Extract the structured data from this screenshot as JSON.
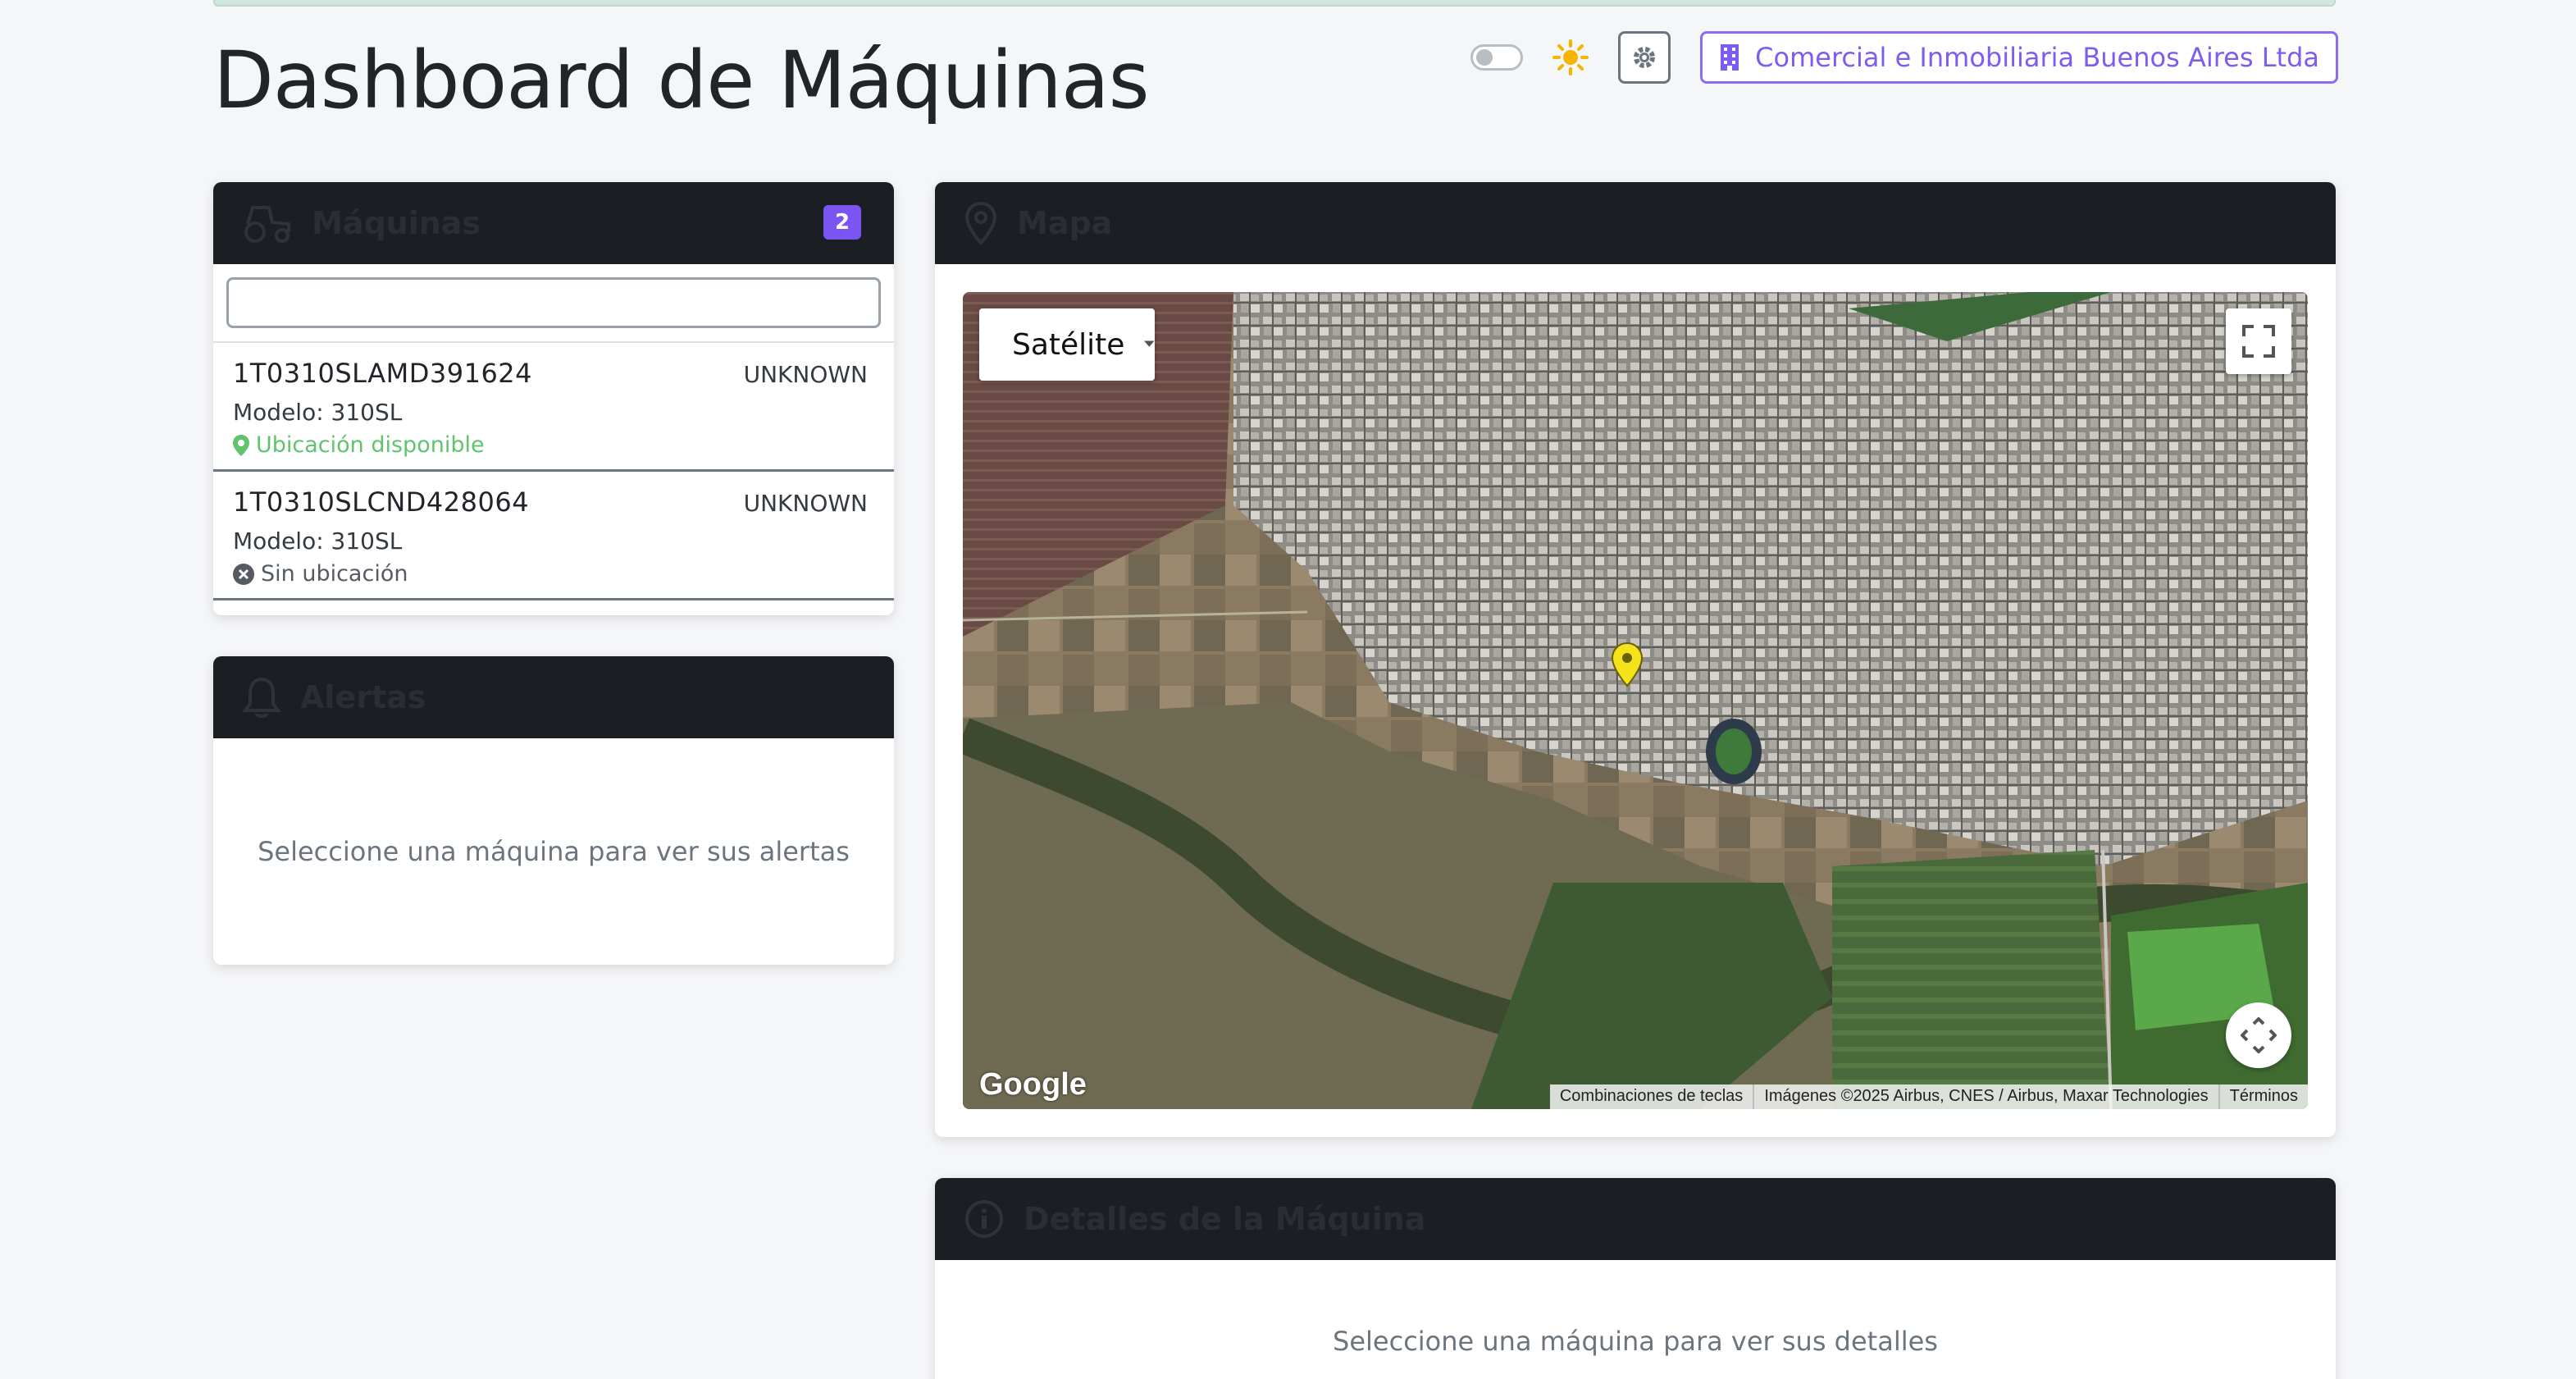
{
  "header": {
    "title": "Dashboard de Máquinas",
    "company_label": "Comercial e Inmobiliaria Buenos Aires Ltda"
  },
  "colors": {
    "accent": "#7a55f2",
    "header_dark": "#1b1e22",
    "location_ok": "#5fc46d",
    "sun": "#f5b400"
  },
  "machines_panel": {
    "title": "Máquinas",
    "count": "2",
    "search": {
      "value": "",
      "placeholder": ""
    },
    "items": [
      {
        "id": "1T0310SLAMD391624",
        "status": "UNKNOWN",
        "model": "Modelo: 310SL",
        "location": "Ubicación disponible",
        "location_icon": "map-pin-icon"
      },
      {
        "id": "1T0310SLCND428064",
        "status": "UNKNOWN",
        "model": "Modelo: 310SL",
        "location": "Sin ubicación",
        "location_icon": "x-circle-icon"
      }
    ]
  },
  "alerts_panel": {
    "title": "Alertas",
    "empty_text": "Seleccione una máquina para ver sus alertas"
  },
  "map_panel": {
    "title": "Mapa",
    "map_type": "Satélite",
    "logo": "Google",
    "attribution": [
      "Combinaciones de teclas",
      "Imágenes ©2025 Airbus, CNES / Airbus, Maxar Technologies",
      "Términos"
    ]
  },
  "details_panel": {
    "title": "Detalles de la Máquina",
    "empty_text": "Seleccione una máquina para ver sus detalles"
  }
}
